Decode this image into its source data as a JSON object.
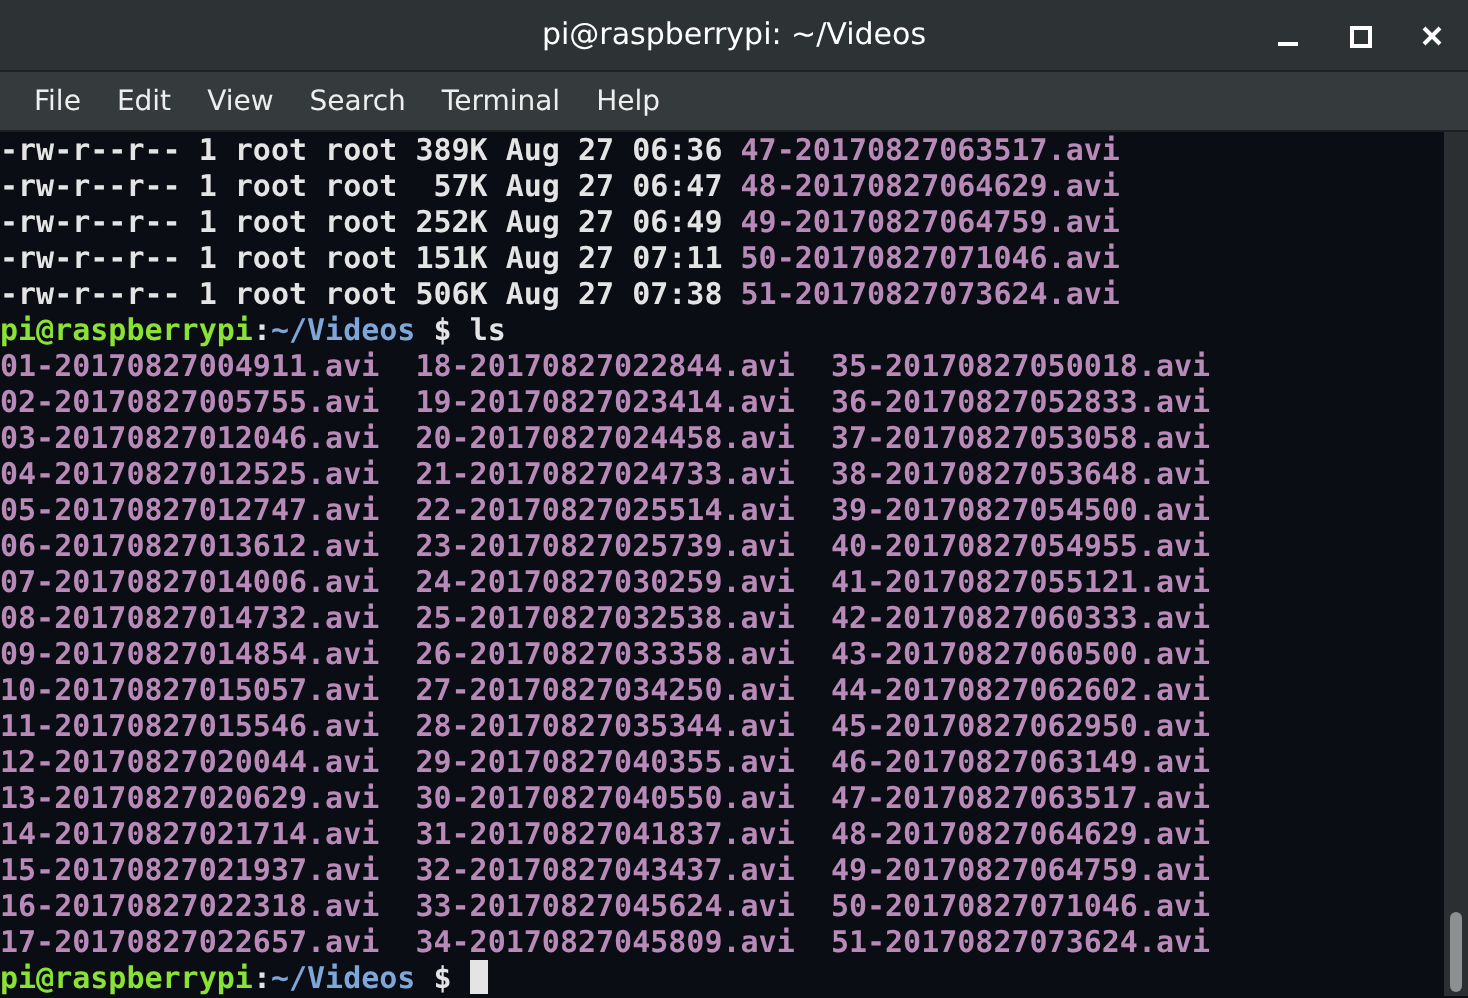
{
  "window": {
    "title": "pi@raspberrypi: ~/Videos",
    "controls": [
      {
        "kind": "minimize"
      },
      {
        "kind": "maximize"
      },
      {
        "kind": "close"
      }
    ]
  },
  "menu": [
    "File",
    "Edit",
    "View",
    "Search",
    "Terminal",
    "Help"
  ],
  "terminal": {
    "long_listing": [
      {
        "details": "-rw-r--r-- 1 root root 389K Aug 27 06:36",
        "file": "47-20170827063517.avi"
      },
      {
        "details": "-rw-r--r-- 1 root root  57K Aug 27 06:47",
        "file": "48-20170827064629.avi"
      },
      {
        "details": "-rw-r--r-- 1 root root 252K Aug 27 06:49",
        "file": "49-20170827064759.avi"
      },
      {
        "details": "-rw-r--r-- 1 root root 151K Aug 27 07:11",
        "file": "50-20170827071046.avi"
      },
      {
        "details": "-rw-r--r-- 1 root root 506K Aug 27 07:38",
        "file": "51-20170827073624.avi"
      }
    ],
    "prompt": {
      "user_host": "pi@raspberrypi",
      "separator": ":",
      "path": "~/Videos",
      "symbol": "$",
      "command": "ls"
    },
    "ls_output": [
      [
        "01-20170827004911.avi",
        "18-20170827022844.avi",
        "35-20170827050018.avi"
      ],
      [
        "02-20170827005755.avi",
        "19-20170827023414.avi",
        "36-20170827052833.avi"
      ],
      [
        "03-20170827012046.avi",
        "20-20170827024458.avi",
        "37-20170827053058.avi"
      ],
      [
        "04-20170827012525.avi",
        "21-20170827024733.avi",
        "38-20170827053648.avi"
      ],
      [
        "05-20170827012747.avi",
        "22-20170827025514.avi",
        "39-20170827054500.avi"
      ],
      [
        "06-20170827013612.avi",
        "23-20170827025739.avi",
        "40-20170827054955.avi"
      ],
      [
        "07-20170827014006.avi",
        "24-20170827030259.avi",
        "41-20170827055121.avi"
      ],
      [
        "08-20170827014732.avi",
        "25-20170827032538.avi",
        "42-20170827060333.avi"
      ],
      [
        "09-20170827014854.avi",
        "26-20170827033358.avi",
        "43-20170827060500.avi"
      ],
      [
        "10-20170827015057.avi",
        "27-20170827034250.avi",
        "44-20170827062602.avi"
      ],
      [
        "11-20170827015546.avi",
        "28-20170827035344.avi",
        "45-20170827062950.avi"
      ],
      [
        "12-20170827020044.avi",
        "29-20170827040355.avi",
        "46-20170827063149.avi"
      ],
      [
        "13-20170827020629.avi",
        "30-20170827040550.avi",
        "47-20170827063517.avi"
      ],
      [
        "14-20170827021714.avi",
        "31-20170827041837.avi",
        "48-20170827064629.avi"
      ],
      [
        "15-20170827021937.avi",
        "32-20170827043437.avi",
        "49-20170827064759.avi"
      ],
      [
        "16-20170827022318.avi",
        "33-20170827045624.avi",
        "50-20170827071046.avi"
      ],
      [
        "17-20170827022657.avi",
        "34-20170827045809.avi",
        "51-20170827073624.avi"
      ]
    ],
    "final_prompt": {
      "user_host": "pi@raspberrypi",
      "separator": ":",
      "path": "~/Videos",
      "symbol": "$"
    }
  }
}
